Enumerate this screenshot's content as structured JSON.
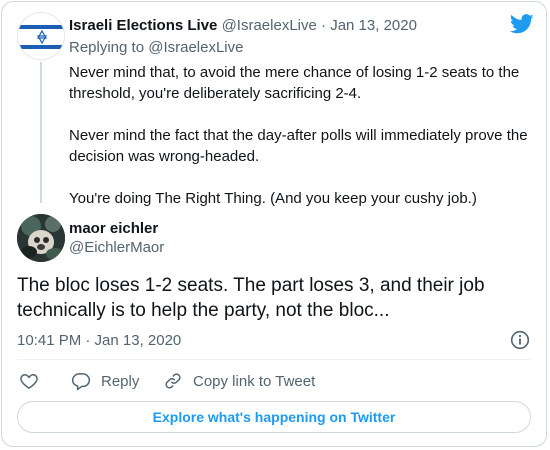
{
  "parent_tweet": {
    "display_name": "Israeli Elections Live",
    "handle": "@IsraelexLive",
    "separator": " · ",
    "date": "Jan 13, 2020",
    "reply_label": "Replying to @IsraelexLive",
    "paragraphs": [
      "Never mind that, to avoid the mere chance of losing 1-2 seats to the threshold, you're deliberately sacrificing 2-4.",
      "Never mind the fact that the day-after polls will immediately prove the decision was wrong-headed.",
      "You're doing The Right Thing. (And you keep your cushy job.)"
    ]
  },
  "main_tweet": {
    "display_name": "maor eichler",
    "handle": "@EichlerMaor",
    "text": "The bloc loses 1-2 seats. The part loses 3, and their job technically is to help the party, not the bloc...",
    "timestamp": "10:41 PM · Jan 13, 2020"
  },
  "actions": {
    "reply_label": "Reply",
    "copy_label": "Copy link to Tweet"
  },
  "explore_label": "Explore what's happening on Twitter",
  "colors": {
    "twitter_blue": "#1d9bf0",
    "muted_text": "#536471",
    "border": "#cfd9de"
  },
  "icons": [
    "israel-flag-avatar",
    "twitter-bird-icon",
    "info-icon",
    "heart-icon",
    "reply-icon",
    "link-icon"
  ]
}
